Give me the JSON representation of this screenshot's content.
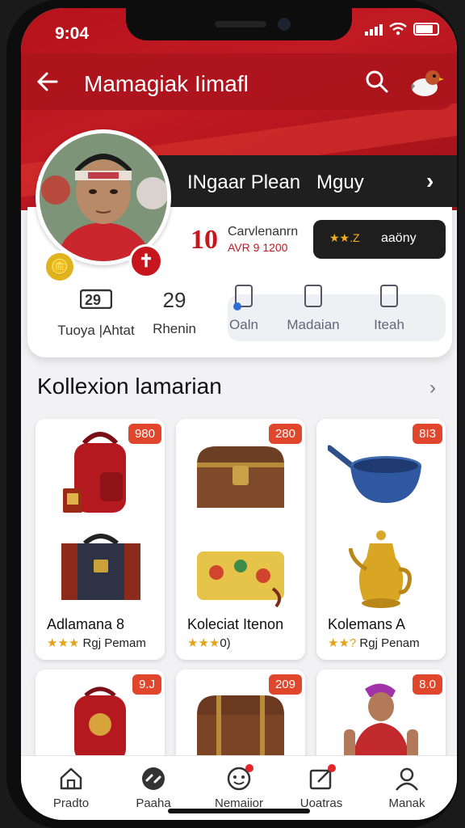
{
  "status": {
    "time": "9:04"
  },
  "topbar": {
    "title": "Mamagiak Iimafl"
  },
  "profile": {
    "name_primary": "INgaar Plean",
    "name_secondary": "Mguy",
    "level_number": "10",
    "level_name": "Carvlenanrn",
    "level_sub": "AVR 9 1200",
    "rating_label": "aaöny",
    "rating_stars": "★★.Z"
  },
  "stats": [
    {
      "value": "29",
      "label": "Tuoya |Ahtat"
    },
    {
      "value": "29",
      "label": "Rhenin"
    }
  ],
  "actions": [
    {
      "label": "Oaln"
    },
    {
      "label": "Madaian"
    },
    {
      "label": "Iteah"
    }
  ],
  "collection": {
    "title": "Kollexion lamarian",
    "items": [
      {
        "price": "980",
        "title": "Adlamana 8",
        "stars": "★★★",
        "meta": "Rgj Pemam",
        "art": "red-backpack"
      },
      {
        "price": "280",
        "title": "Koleciat Itenon",
        "stars": "★★★",
        "meta": "0)",
        "art": "wooden-chest"
      },
      {
        "price": "8I3",
        "title": "Kolemans A",
        "stars": "★★?",
        "meta": "Rgj Penam",
        "art": "blue-pot"
      },
      {
        "price": "9.J",
        "art": "red-backpack-2"
      },
      {
        "price": "209",
        "art": "brown-chest"
      },
      {
        "price": "8.0",
        "art": "fighter"
      }
    ]
  },
  "bottom_nav": [
    {
      "label": "Pradto",
      "icon": "home-icon"
    },
    {
      "label": "Paaha",
      "icon": "controller-icon"
    },
    {
      "label": "Nemaiior",
      "icon": "face-icon"
    },
    {
      "label": "Uoatras",
      "icon": "edit-icon"
    },
    {
      "label": "Manak",
      "icon": "user-icon"
    }
  ],
  "colors": {
    "brand_red": "#c21a23",
    "price_orange": "#e0462b",
    "star_gold": "#e3a21a"
  }
}
